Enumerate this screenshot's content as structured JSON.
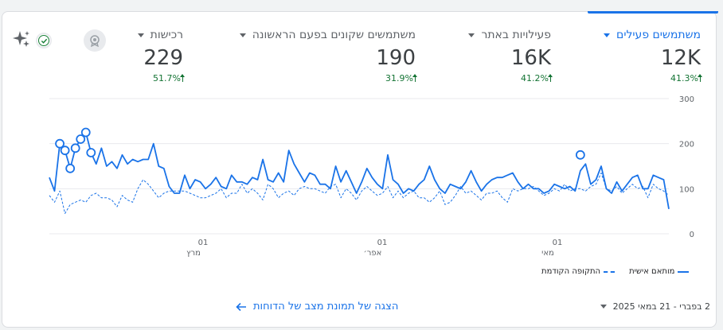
{
  "metrics": [
    {
      "label": "משתמשים פעילים",
      "value": "12K",
      "change": "41.3%",
      "active": true
    },
    {
      "label": "פעילויות באתר",
      "value": "16K",
      "change": "41.2%",
      "active": false
    },
    {
      "label": "משתמשים שקונים בפעם הראשונה",
      "value": "190",
      "change": "31.9%",
      "active": false
    },
    {
      "label": "רכישות",
      "value": "229",
      "change": "51.7%",
      "active": false
    }
  ],
  "icons": {
    "sparkle": "sparkle-icon",
    "check": "check-circle-icon",
    "badge": "achievement-badge-icon",
    "arrow": "arrow-left-icon"
  },
  "legend": {
    "current": "מותאם אישית",
    "previous": "התקופה הקודמת"
  },
  "footer": {
    "link_label": "הצגה של תמונת מצב של הדוחות",
    "date_range": "2 בפברי - 21 במאי 2025"
  },
  "colors": {
    "accent": "#1a73e8",
    "positive": "#137333"
  },
  "chart_data": {
    "type": "line",
    "y_ticks": [
      "300",
      "200",
      "100",
      "0"
    ],
    "ylim": [
      0,
      300
    ],
    "x_ticks": [
      {
        "day": "01",
        "month": "מרץ"
      },
      {
        "day": "01",
        "month": "אפר׳"
      },
      {
        "day": "01",
        "month": "מאי"
      }
    ],
    "series": [
      {
        "name": "מותאם אישית",
        "style": "solid",
        "values": [
          125,
          95,
          200,
          185,
          145,
          190,
          210,
          225,
          180,
          155,
          190,
          150,
          160,
          145,
          175,
          155,
          165,
          160,
          165,
          165,
          200,
          150,
          145,
          105,
          90,
          90,
          130,
          100,
          120,
          115,
          100,
          110,
          125,
          105,
          100,
          130,
          115,
          115,
          110,
          125,
          120,
          165,
          120,
          115,
          135,
          115,
          185,
          155,
          135,
          115,
          135,
          130,
          110,
          110,
          100,
          150,
          115,
          140,
          115,
          90,
          115,
          145,
          125,
          110,
          100,
          175,
          120,
          110,
          90,
          100,
          95,
          110,
          120,
          150,
          120,
          100,
          90,
          110,
          105,
          100,
          115,
          140,
          115,
          95,
          110,
          120,
          125,
          125,
          130,
          135,
          115,
          100,
          110,
          100,
          100,
          90,
          95,
          110,
          105,
          100,
          105,
          95,
          140,
          155,
          110,
          120,
          150,
          100,
          90,
          115,
          95,
          110,
          125,
          130,
          100,
          100,
          130,
          125,
          120,
          55
        ],
        "markers": [
          200,
          185,
          145,
          190,
          210,
          225,
          180,
          175
        ]
      },
      {
        "name": "התקופה הקודמת",
        "style": "dashed",
        "values": [
          85,
          70,
          95,
          45,
          65,
          70,
          75,
          70,
          85,
          90,
          80,
          80,
          75,
          60,
          85,
          75,
          70,
          100,
          120,
          110,
          95,
          80,
          90,
          95,
          95,
          95,
          95,
          90,
          85,
          80,
          80,
          85,
          90,
          100,
          80,
          90,
          90,
          110,
          90,
          100,
          90,
          75,
          110,
          100,
          80,
          90,
          95,
          85,
          100,
          105,
          100,
          100,
          95,
          90,
          105,
          110,
          80,
          100,
          90,
          75,
          95,
          105,
          95,
          85,
          90,
          105,
          80,
          95,
          80,
          90,
          95,
          80,
          80,
          70,
          80,
          95,
          65,
          70,
          85,
          105,
          90,
          95,
          85,
          75,
          90,
          90,
          95,
          80,
          70,
          100,
          95,
          100,
          100,
          105,
          95,
          85,
          90,
          100,
          95,
          110,
          95,
          100,
          100,
          95,
          105,
          110,
          135,
          100,
          95,
          105,
          90,
          100,
          110,
          100,
          105,
          80,
          110,
          100,
          95,
          85
        ]
      }
    ]
  }
}
